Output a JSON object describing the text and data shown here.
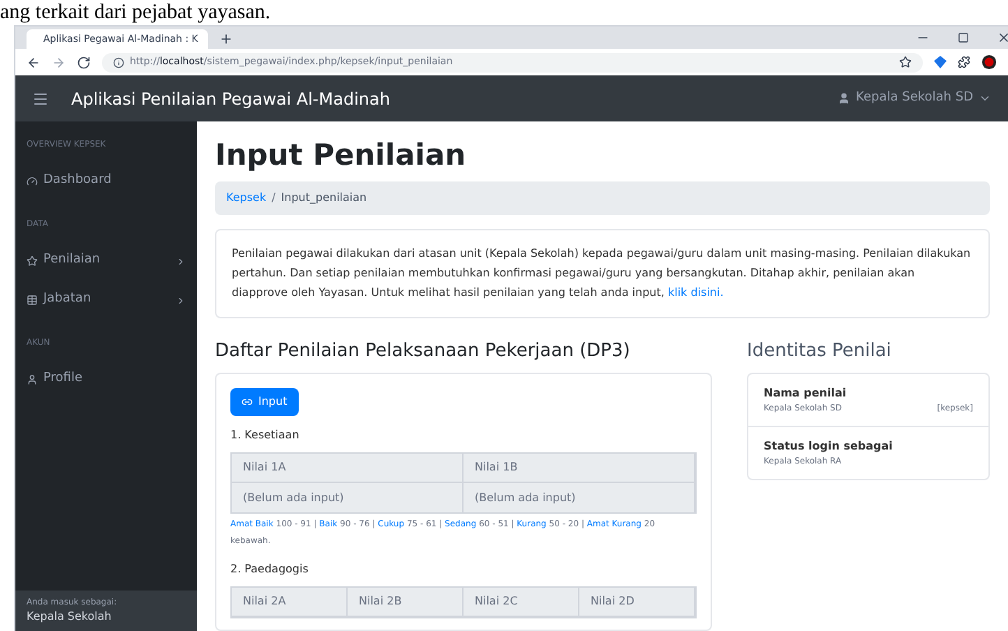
{
  "document_text": "ang terkait dari pejabat yayasan.",
  "browser": {
    "tab_title": "Aplikasi Pegawai Al-Madinah : K",
    "url_prefix": "http://",
    "url_host": "localhost",
    "url_path": "/sistem_pegawai/index.php/kepsek/input_penilaian"
  },
  "navbar": {
    "brand": "Aplikasi Penilaian Pegawai Al-Madinah",
    "user": "Kepala Sekolah SD"
  },
  "sidebar": {
    "sections": [
      {
        "heading": "OVERVIEW KEPSEK",
        "items": [
          {
            "label": "Dashboard",
            "has_submenu": false
          }
        ]
      },
      {
        "heading": "DATA",
        "items": [
          {
            "label": "Penilaian",
            "has_submenu": true
          },
          {
            "label": "Jabatan",
            "has_submenu": true
          }
        ]
      },
      {
        "heading": "AKUN",
        "items": [
          {
            "label": "Profile",
            "has_submenu": false
          }
        ]
      }
    ],
    "footer_label": "Anda masuk sebagai:",
    "footer_value": "Kepala Sekolah"
  },
  "page": {
    "title": "Input Penilaian",
    "breadcrumb": [
      {
        "label": "Kepsek",
        "link": true
      },
      {
        "label": "Input_penilaian",
        "link": false
      }
    ],
    "breadcrumb_separator": "/",
    "info_text": "Penilaian pegawai dilakukan dari atasan unit (Kepala Sekolah) kepada pegawai/guru dalam unit masing-masing. Penilaian dilakukan pertahun. Dan setiap penilaian membutuhkan konfirmasi pegawai/guru yang bersangkutan. Ditahap akhir, penilaian akan diapprove oleh Yayasan. Untuk melihat hasil penilaian yang telah anda input,",
    "info_link": "klik disini."
  },
  "dp3": {
    "title": "Daftar Penilaian Pelaksanaan Pekerjaan (DP3)",
    "input_button": "Input",
    "groups": [
      {
        "title": "1. Kesetiaan",
        "columns": [
          "Nilai 1A",
          "Nilai 1B"
        ],
        "values": [
          "(Belum ada input)",
          "(Belum ada input)"
        ],
        "legend": [
          {
            "label": "Amat Baik",
            "range": "100 - 91"
          },
          {
            "label": "Baik",
            "range": "90 - 76"
          },
          {
            "label": "Cukup",
            "range": "75 - 61"
          },
          {
            "label": "Sedang",
            "range": "60 - 51"
          },
          {
            "label": "Kurang",
            "range": "50 - 20"
          },
          {
            "label": "Amat Kurang",
            "range": "20 kebawah."
          }
        ],
        "separator": "|"
      },
      {
        "title": "2. Paedagogis",
        "columns": [
          "Nilai 2A",
          "Nilai 2B",
          "Nilai 2C",
          "Nilai 2D"
        ]
      }
    ]
  },
  "identity": {
    "title": "Identitas Penilai",
    "rows": [
      {
        "label": "Nama penilai",
        "value": "Kepala Sekolah SD",
        "tag": "[kepsek]"
      },
      {
        "label": "Status login sebagai",
        "value": "Kepala Sekolah RA"
      }
    ]
  }
}
